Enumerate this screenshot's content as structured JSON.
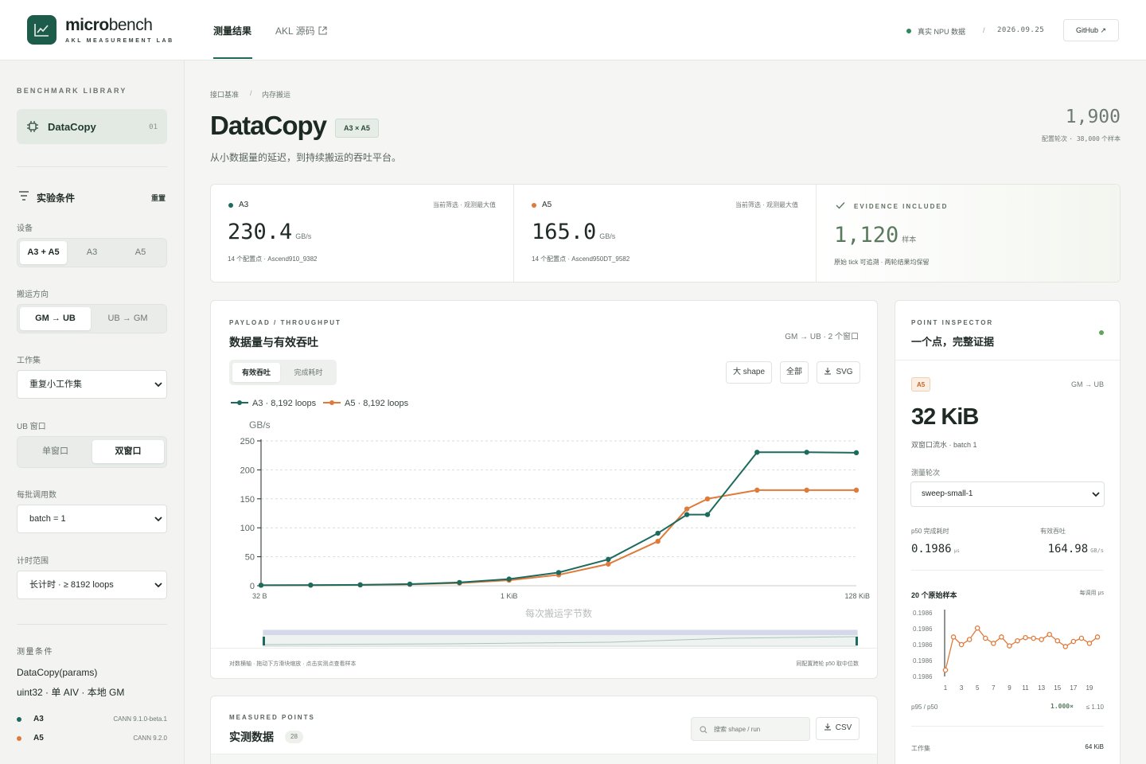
{
  "header": {
    "brand_bold": "micro",
    "brand_light": "bench",
    "brand_sub": "AKL MEASUREMENT LAB",
    "tabs": [
      {
        "label": "测量结果"
      },
      {
        "label": "AKL 源码"
      }
    ],
    "status": "真实 NPU 数据",
    "sep": "/",
    "date": "2026.09.25",
    "github": "GitHub ↗"
  },
  "sidebar": {
    "library_cap": "BENCHMARK LIBRARY",
    "item": {
      "name": "DataCopy",
      "num": "01"
    },
    "conditions_title": "实验条件",
    "reset": "重置",
    "device_label": "设备",
    "device_options": [
      "A3 + A5",
      "A3",
      "A5"
    ],
    "direction_label": "搬运方向",
    "direction_options": [
      "GM → UB",
      "UB → GM"
    ],
    "workset_label": "工作集",
    "workset_value": "重复小工作集",
    "window_label": "UB 窗口",
    "window_options": [
      "单窗口",
      "双窗口"
    ],
    "batch_label": "每批调用数",
    "batch_value": "batch = 1",
    "timing_label": "计时范围",
    "timing_value": "长计时 · ≥ 8192 loops",
    "measure_cap": "测量条件",
    "signature": "DataCopy(params)",
    "signature_detail": "uint32 · 单 AIV · 本地 GM",
    "env": [
      {
        "name": "A3",
        "version": "CANN 9.1.0-beta.1",
        "color": "#1d6b5e"
      },
      {
        "name": "A5",
        "version": "CANN 9.2.0",
        "color": "#e07a3a"
      }
    ]
  },
  "main": {
    "breadcrumb": [
      "接口基准",
      "/",
      "内存搬运"
    ],
    "title": "DataCopy",
    "pill": "A3 × A5",
    "subtitle": "从小数据量的延迟，到持续搬运的吞吐平台。",
    "count": "1,900",
    "count_sub_a": "配置轮次",
    "count_sub_b": "· 38,000",
    "count_sub_c": "个样本",
    "stats": [
      {
        "name": "A3",
        "note": "当前筛选 · 观测最大值",
        "value": "230.4",
        "unit": "GB/s",
        "foot": "14 个配置点 · Ascend910_9382",
        "color": "#1d6b5e"
      },
      {
        "name": "A5",
        "note": "当前筛选 · 观测最大值",
        "value": "165.0",
        "unit": "GB/s",
        "foot": "14 个配置点 · Ascend950DT_9582",
        "color": "#e07a3a"
      }
    ],
    "evidence": {
      "cap": "EVIDENCE INCLUDED",
      "value": "1,120",
      "unit": "样本",
      "foot": "原始 tick 可追溯 · 两轮结果均保留"
    }
  },
  "chart_panel": {
    "cap": "PAYLOAD / THROUGHPUT",
    "title": "数据量与有效吞吐",
    "meta": "GM → UB · 2 个窗口",
    "tabs": [
      "有效吞吐",
      "完成耗时"
    ],
    "btn_shape": "大 shape",
    "btn_all": "全部",
    "btn_svg": "SVG",
    "foot_left": "对数横轴 · 拖动下方滑块缩放 · 点击实测点查看样本",
    "foot_right": "同配置跨轮 p50 取中位数"
  },
  "chart_data": {
    "type": "line",
    "ylabel": "GB/s",
    "xlabel": "每次搬运字节数",
    "x_scale": "log2",
    "x": [
      32,
      64,
      128,
      256,
      512,
      1024,
      2048,
      4096,
      8192,
      12288,
      16384,
      32768,
      65536,
      131072
    ],
    "x_ticks": [
      {
        "value": 32,
        "label": "32 B"
      },
      {
        "value": 1024,
        "label": "1 KiB"
      },
      {
        "value": 131072,
        "label": "128 KiB"
      }
    ],
    "ylim": [
      0,
      250
    ],
    "y_ticks": [
      0,
      50,
      100,
      150,
      200,
      250
    ],
    "grid": true,
    "series": [
      {
        "name": "A3 · 8,192 loops",
        "color": "#1d6b5e",
        "values": [
          0.9,
          1.1,
          1.6,
          2.8,
          5.6,
          11.5,
          22.8,
          45.5,
          90.6,
          122.8,
          122.8,
          230.4,
          230.4,
          229.6
        ]
      },
      {
        "name": "A5 · 8,192 loops",
        "color": "#e07a3a",
        "values": [
          0.9,
          1.0,
          1.4,
          2.4,
          4.6,
          9.5,
          18.8,
          37.4,
          76.7,
          132.5,
          150.0,
          165.0,
          165.0,
          165.0
        ]
      }
    ]
  },
  "inspector": {
    "cap": "POINT INSPECTOR",
    "title": "一个点，完整证据",
    "badge": "A5",
    "direction": "GM → UB",
    "size": "32 KiB",
    "size_detail": "双窗口流水 · batch 1",
    "round_label": "测量轮次",
    "round_value": "sweep-small-1",
    "p50_label": "p50 完成耗时",
    "p50_value": "0.1986",
    "p50_unit": "μs",
    "tp_label": "有效吞吐",
    "tp_value": "164.98",
    "tp_unit": "GB/s",
    "samples_title": "20 个原始样本",
    "samples_unit": "每调用 μs",
    "sample_y_labels": [
      "0.1986",
      "0.1986",
      "0.1986",
      "0.1986",
      "0.1986"
    ],
    "sample_x_labels": [
      "1",
      "3",
      "5",
      "7",
      "9",
      "11",
      "13",
      "15",
      "17",
      "19"
    ],
    "samples_rel": [
      0.1,
      0.62,
      0.5,
      0.58,
      0.76,
      0.6,
      0.52,
      0.62,
      0.48,
      0.56,
      0.61,
      0.6,
      0.58,
      0.66,
      0.56,
      0.47,
      0.55,
      0.6,
      0.52,
      0.62
    ],
    "p95_label": "p95 / p50",
    "p95_value": "1.000×",
    "p95_limit": "≤ 1.10",
    "workset_label": "工作集",
    "workset_value": "64 KiB"
  },
  "table_panel": {
    "cap": "MEASURED POINTS",
    "title": "实测数据",
    "count": "28",
    "search_placeholder": "搜索 shape / run",
    "csv": "CSV"
  }
}
